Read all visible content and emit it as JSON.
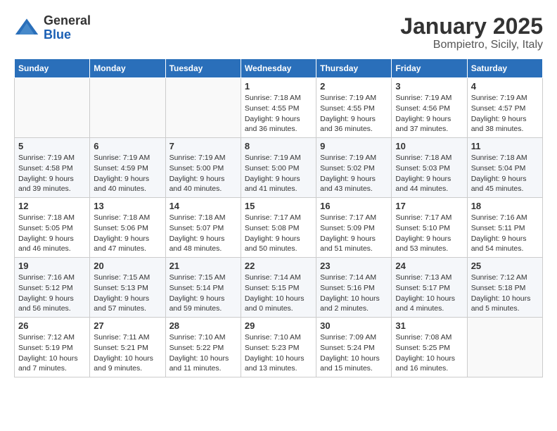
{
  "header": {
    "logo_general": "General",
    "logo_blue": "Blue",
    "title": "January 2025",
    "subtitle": "Bompietro, Sicily, Italy"
  },
  "weekdays": [
    "Sunday",
    "Monday",
    "Tuesday",
    "Wednesday",
    "Thursday",
    "Friday",
    "Saturday"
  ],
  "weeks": [
    [
      {
        "day": "",
        "info": ""
      },
      {
        "day": "",
        "info": ""
      },
      {
        "day": "",
        "info": ""
      },
      {
        "day": "1",
        "info": "Sunrise: 7:18 AM\nSunset: 4:55 PM\nDaylight: 9 hours\nand 36 minutes."
      },
      {
        "day": "2",
        "info": "Sunrise: 7:19 AM\nSunset: 4:55 PM\nDaylight: 9 hours\nand 36 minutes."
      },
      {
        "day": "3",
        "info": "Sunrise: 7:19 AM\nSunset: 4:56 PM\nDaylight: 9 hours\nand 37 minutes."
      },
      {
        "day": "4",
        "info": "Sunrise: 7:19 AM\nSunset: 4:57 PM\nDaylight: 9 hours\nand 38 minutes."
      }
    ],
    [
      {
        "day": "5",
        "info": "Sunrise: 7:19 AM\nSunset: 4:58 PM\nDaylight: 9 hours\nand 39 minutes."
      },
      {
        "day": "6",
        "info": "Sunrise: 7:19 AM\nSunset: 4:59 PM\nDaylight: 9 hours\nand 40 minutes."
      },
      {
        "day": "7",
        "info": "Sunrise: 7:19 AM\nSunset: 5:00 PM\nDaylight: 9 hours\nand 40 minutes."
      },
      {
        "day": "8",
        "info": "Sunrise: 7:19 AM\nSunset: 5:00 PM\nDaylight: 9 hours\nand 41 minutes."
      },
      {
        "day": "9",
        "info": "Sunrise: 7:19 AM\nSunset: 5:02 PM\nDaylight: 9 hours\nand 43 minutes."
      },
      {
        "day": "10",
        "info": "Sunrise: 7:18 AM\nSunset: 5:03 PM\nDaylight: 9 hours\nand 44 minutes."
      },
      {
        "day": "11",
        "info": "Sunrise: 7:18 AM\nSunset: 5:04 PM\nDaylight: 9 hours\nand 45 minutes."
      }
    ],
    [
      {
        "day": "12",
        "info": "Sunrise: 7:18 AM\nSunset: 5:05 PM\nDaylight: 9 hours\nand 46 minutes."
      },
      {
        "day": "13",
        "info": "Sunrise: 7:18 AM\nSunset: 5:06 PM\nDaylight: 9 hours\nand 47 minutes."
      },
      {
        "day": "14",
        "info": "Sunrise: 7:18 AM\nSunset: 5:07 PM\nDaylight: 9 hours\nand 48 minutes."
      },
      {
        "day": "15",
        "info": "Sunrise: 7:17 AM\nSunset: 5:08 PM\nDaylight: 9 hours\nand 50 minutes."
      },
      {
        "day": "16",
        "info": "Sunrise: 7:17 AM\nSunset: 5:09 PM\nDaylight: 9 hours\nand 51 minutes."
      },
      {
        "day": "17",
        "info": "Sunrise: 7:17 AM\nSunset: 5:10 PM\nDaylight: 9 hours\nand 53 minutes."
      },
      {
        "day": "18",
        "info": "Sunrise: 7:16 AM\nSunset: 5:11 PM\nDaylight: 9 hours\nand 54 minutes."
      }
    ],
    [
      {
        "day": "19",
        "info": "Sunrise: 7:16 AM\nSunset: 5:12 PM\nDaylight: 9 hours\nand 56 minutes."
      },
      {
        "day": "20",
        "info": "Sunrise: 7:15 AM\nSunset: 5:13 PM\nDaylight: 9 hours\nand 57 minutes."
      },
      {
        "day": "21",
        "info": "Sunrise: 7:15 AM\nSunset: 5:14 PM\nDaylight: 9 hours\nand 59 minutes."
      },
      {
        "day": "22",
        "info": "Sunrise: 7:14 AM\nSunset: 5:15 PM\nDaylight: 10 hours\nand 0 minutes."
      },
      {
        "day": "23",
        "info": "Sunrise: 7:14 AM\nSunset: 5:16 PM\nDaylight: 10 hours\nand 2 minutes."
      },
      {
        "day": "24",
        "info": "Sunrise: 7:13 AM\nSunset: 5:17 PM\nDaylight: 10 hours\nand 4 minutes."
      },
      {
        "day": "25",
        "info": "Sunrise: 7:12 AM\nSunset: 5:18 PM\nDaylight: 10 hours\nand 5 minutes."
      }
    ],
    [
      {
        "day": "26",
        "info": "Sunrise: 7:12 AM\nSunset: 5:19 PM\nDaylight: 10 hours\nand 7 minutes."
      },
      {
        "day": "27",
        "info": "Sunrise: 7:11 AM\nSunset: 5:21 PM\nDaylight: 10 hours\nand 9 minutes."
      },
      {
        "day": "28",
        "info": "Sunrise: 7:10 AM\nSunset: 5:22 PM\nDaylight: 10 hours\nand 11 minutes."
      },
      {
        "day": "29",
        "info": "Sunrise: 7:10 AM\nSunset: 5:23 PM\nDaylight: 10 hours\nand 13 minutes."
      },
      {
        "day": "30",
        "info": "Sunrise: 7:09 AM\nSunset: 5:24 PM\nDaylight: 10 hours\nand 15 minutes."
      },
      {
        "day": "31",
        "info": "Sunrise: 7:08 AM\nSunset: 5:25 PM\nDaylight: 10 hours\nand 16 minutes."
      },
      {
        "day": "",
        "info": ""
      }
    ]
  ]
}
